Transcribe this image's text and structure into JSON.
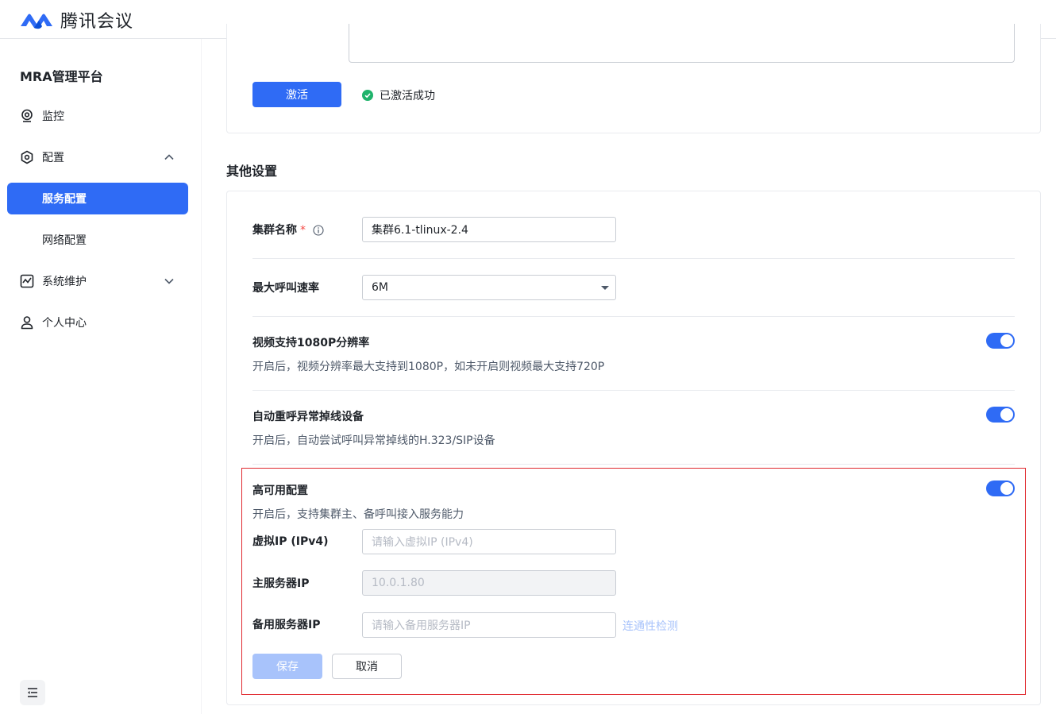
{
  "app": {
    "name": "腾讯会议"
  },
  "sidebar": {
    "title": "MRA管理平台",
    "items": [
      {
        "label": "监控",
        "icon": "monitor-icon"
      },
      {
        "label": "配置",
        "icon": "gear-icon",
        "expanded": true
      },
      {
        "label": "服务配置",
        "active": true
      },
      {
        "label": "网络配置"
      },
      {
        "label": "系统维护",
        "icon": "chart-icon",
        "expanded": false
      },
      {
        "label": "个人中心",
        "icon": "user-icon"
      }
    ]
  },
  "activation": {
    "button": "激活",
    "status": "已激活成功"
  },
  "other_settings": {
    "title": "其他设置",
    "cluster_name": {
      "label": "集群名称",
      "required_mark": "*",
      "value": "集群6.1-tlinux-2.4"
    },
    "max_call_rate": {
      "label": "最大呼叫速率",
      "value": "6M"
    },
    "video_1080p": {
      "label": "视频支持1080P分辨率",
      "desc": "开启后，视频分辨率最大支持到1080P，如未开启则视频最大支持720P",
      "enabled": true
    },
    "auto_redial": {
      "label": "自动重呼异常掉线设备",
      "desc": "开启后，自动尝试呼叫异常掉线的H.323/SIP设备",
      "enabled": true
    },
    "ha": {
      "label": "高可用配置",
      "desc": "开启后，支持集群主、备呼叫接入服务能力",
      "enabled": true,
      "virtual_ip": {
        "label": "虚拟IP (IPv4)",
        "placeholder": "请输入虚拟IP (IPv4)"
      },
      "primary_ip": {
        "label": "主服务器IP",
        "value": "10.0.1.80"
      },
      "backup_ip": {
        "label": "备用服务器IP",
        "placeholder": "请输入备用服务器IP"
      },
      "connectivity_link": "连通性检测",
      "save": "保存",
      "cancel": "取消"
    }
  },
  "colors": {
    "accent": "#2f6bf5",
    "success": "#1fb36b",
    "highlight_border": "#e0282e"
  }
}
